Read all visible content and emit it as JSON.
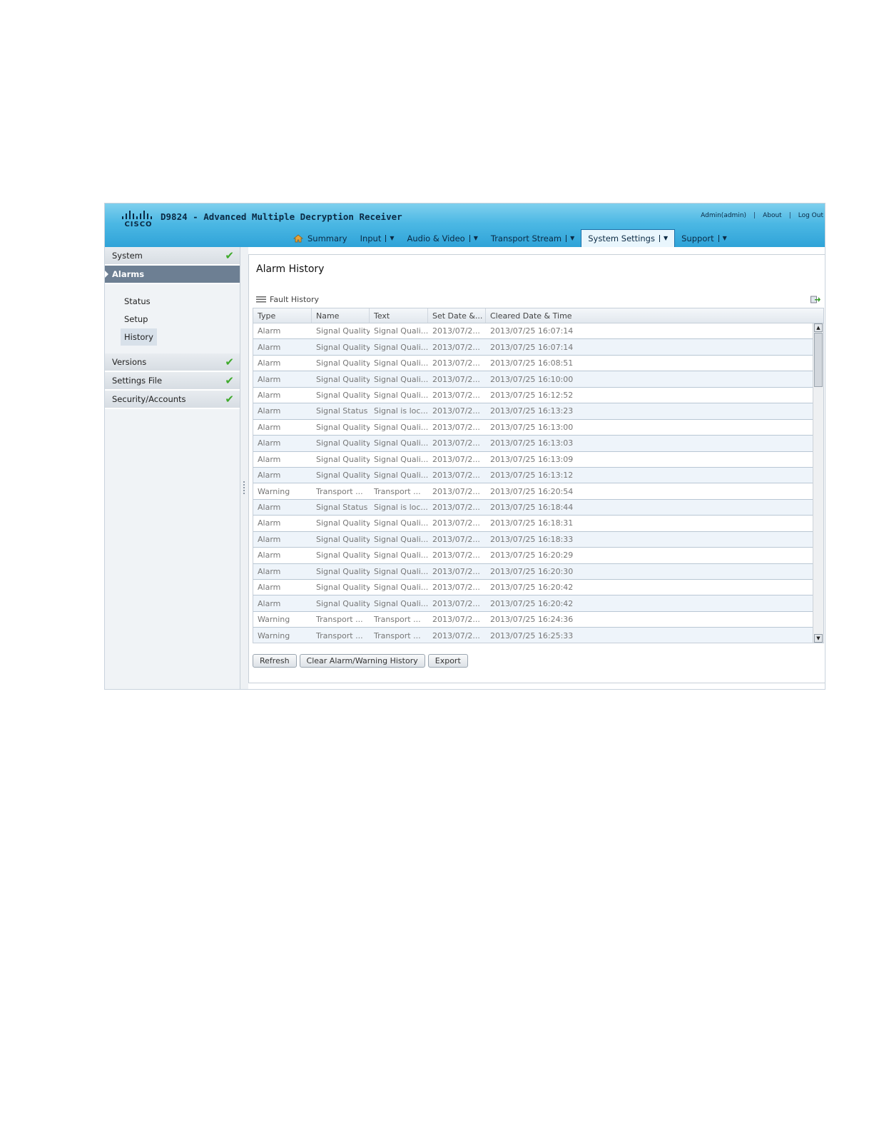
{
  "header": {
    "logo_word": "CISCO",
    "title": "D9824 - Advanced Multiple Decryption Receiver",
    "links": [
      "Admin(admin)",
      "About",
      "Log Out"
    ],
    "link_separator": "|"
  },
  "nav": {
    "items": [
      {
        "label": "Summary",
        "icon": "home-icon",
        "dropdown": false
      },
      {
        "label": "Input",
        "dropdown": true
      },
      {
        "label": "Audio & Video",
        "dropdown": true
      },
      {
        "label": "Transport Stream",
        "dropdown": true
      },
      {
        "label": "System Settings",
        "dropdown": true,
        "active": true
      },
      {
        "label": "Support",
        "dropdown": true
      }
    ],
    "dropdown_glyph": "▼"
  },
  "sidebar": {
    "sections": [
      {
        "label": "System",
        "status_icon": "check-icon"
      },
      {
        "label": "Alarms",
        "active": true
      },
      {
        "label": "Versions",
        "status_icon": "check-icon"
      },
      {
        "label": "Settings File",
        "status_icon": "check-icon"
      },
      {
        "label": "Security/Accounts",
        "status_icon": "check-icon"
      }
    ],
    "alarms_sub": [
      "Status",
      "Setup",
      "History"
    ],
    "active_sub": "History",
    "check_glyph": "✔"
  },
  "main": {
    "title": "Alarm History",
    "grid_title": "Fault History",
    "columns": [
      "Type",
      "Name",
      "Text",
      "Set Date &...",
      "Cleared Date & Time"
    ],
    "rows": [
      [
        "Alarm",
        "Signal Quality",
        "Signal Quali...",
        "2013/07/2...",
        "2013/07/25 16:07:14"
      ],
      [
        "Alarm",
        "Signal Quality",
        "Signal Quali...",
        "2013/07/2...",
        "2013/07/25 16:07:14"
      ],
      [
        "Alarm",
        "Signal Quality",
        "Signal Quali...",
        "2013/07/2...",
        "2013/07/25 16:08:51"
      ],
      [
        "Alarm",
        "Signal Quality",
        "Signal Quali...",
        "2013/07/2...",
        "2013/07/25 16:10:00"
      ],
      [
        "Alarm",
        "Signal Quality",
        "Signal Quali...",
        "2013/07/2...",
        "2013/07/25 16:12:52"
      ],
      [
        "Alarm",
        "Signal Status",
        "Signal is loc...",
        "2013/07/2...",
        "2013/07/25 16:13:23"
      ],
      [
        "Alarm",
        "Signal Quality",
        "Signal Quali...",
        "2013/07/2...",
        "2013/07/25 16:13:00"
      ],
      [
        "Alarm",
        "Signal Quality",
        "Signal Quali...",
        "2013/07/2...",
        "2013/07/25 16:13:03"
      ],
      [
        "Alarm",
        "Signal Quality",
        "Signal Quali...",
        "2013/07/2...",
        "2013/07/25 16:13:09"
      ],
      [
        "Alarm",
        "Signal Quality",
        "Signal Quali...",
        "2013/07/2...",
        "2013/07/25 16:13:12"
      ],
      [
        "Warning",
        "Transport ...",
        "Transport ...",
        "2013/07/2...",
        "2013/07/25 16:20:54"
      ],
      [
        "Alarm",
        "Signal Status",
        "Signal is loc...",
        "2013/07/2...",
        "2013/07/25 16:18:44"
      ],
      [
        "Alarm",
        "Signal Quality",
        "Signal Quali...",
        "2013/07/2...",
        "2013/07/25 16:18:31"
      ],
      [
        "Alarm",
        "Signal Quality",
        "Signal Quali...",
        "2013/07/2...",
        "2013/07/25 16:18:33"
      ],
      [
        "Alarm",
        "Signal Quality",
        "Signal Quali...",
        "2013/07/2...",
        "2013/07/25 16:20:29"
      ],
      [
        "Alarm",
        "Signal Quality",
        "Signal Quali...",
        "2013/07/2...",
        "2013/07/25 16:20:30"
      ],
      [
        "Alarm",
        "Signal Quality",
        "Signal Quali...",
        "2013/07/2...",
        "2013/07/25 16:20:42"
      ],
      [
        "Alarm",
        "Signal Quality",
        "Signal Quali...",
        "2013/07/2...",
        "2013/07/25 16:20:42"
      ],
      [
        "Warning",
        "Transport ...",
        "Transport ...",
        "2013/07/2...",
        "2013/07/25 16:24:36"
      ],
      [
        "Warning",
        "Transport ...",
        "Transport ...",
        "2013/07/2...",
        "2013/07/25 16:25:33"
      ]
    ],
    "buttons": [
      "Refresh",
      "Clear Alarm/Warning History",
      "Export"
    ]
  },
  "colors": {
    "header_blue": "#2fa3d8",
    "sidebar_active": "#6d7f93",
    "check_green": "#3faa2c"
  }
}
